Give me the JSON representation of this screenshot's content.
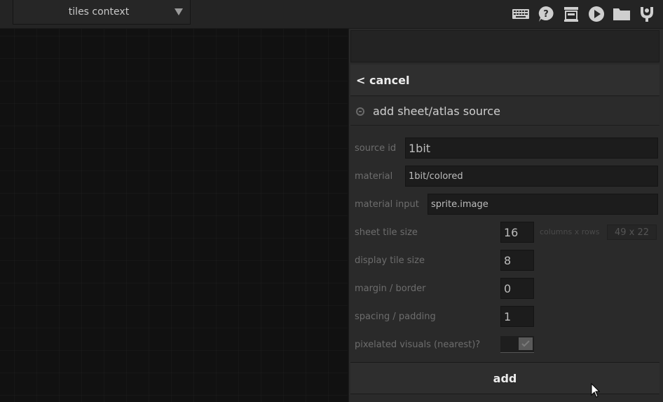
{
  "topbar": {
    "context_label": "tiles context",
    "icons": [
      "keyboard-icon",
      "help-icon",
      "inspector-icon",
      "play-icon",
      "folder-icon",
      "luxe-icon"
    ]
  },
  "panel": {
    "cancel_label": "< cancel",
    "section_title": "add sheet/atlas source",
    "fields": {
      "source_id": {
        "label": "source id",
        "value": "1bit"
      },
      "material": {
        "label": "material",
        "value": "1bit/colored"
      },
      "material_input": {
        "label": "material input",
        "value": "sprite.image"
      },
      "sheet_tile_size": {
        "label": "sheet tile size",
        "value": "16",
        "hint": "columns x rows",
        "readout": "49 x 22"
      },
      "display_tile_size": {
        "label": "display tile size",
        "value": "8"
      },
      "margin_border": {
        "label": "margin / border",
        "value": "0"
      },
      "spacing_padding": {
        "label": "spacing / padding",
        "value": "1"
      },
      "pixelated": {
        "label": "pixelated visuals (nearest)?",
        "checked": true
      }
    },
    "add_label": "add"
  },
  "colors": {
    "background": "#121212",
    "panel": "#2a2a2a",
    "field": "#1c1c1c",
    "text": "#ececec",
    "label": "#6d6d6d"
  }
}
